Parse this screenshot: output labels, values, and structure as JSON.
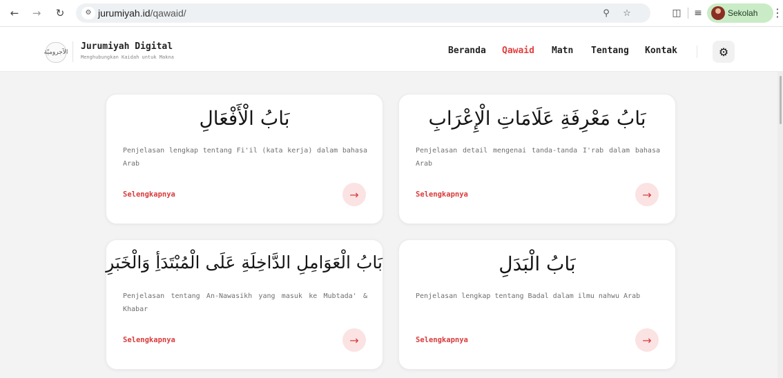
{
  "browser": {
    "url_domain": "jurumiyah.id",
    "url_path": "/qawaid/",
    "profile_name": "Sekolah",
    "icons": {
      "back": "back-arrow-icon",
      "forward": "forward-arrow-icon",
      "reload": "reload-icon",
      "site_info": "site-info-icon",
      "zoom": "zoom-icon",
      "bookmark": "star-icon",
      "extensions": "puzzle-icon",
      "media": "media-control-icon",
      "menu": "kebab-menu-icon"
    }
  },
  "site": {
    "logo_text": "الآجروميّة",
    "brand_title": "Jurumiyah Digital",
    "brand_subtitle": "Menghubungkan Kaidah untuk Makna",
    "nav": [
      {
        "label": "Beranda",
        "active": false
      },
      {
        "label": "Qawaid",
        "active": true
      },
      {
        "label": "Matn",
        "active": false
      },
      {
        "label": "Tentang",
        "active": false
      },
      {
        "label": "Kontak",
        "active": false
      }
    ],
    "accent_color": "#e23f3f",
    "settings_icon": "gear-icon"
  },
  "cards": [
    {
      "title": "بَابُ الْأَفْعَالِ",
      "description": "Penjelasan lengkap tentang Fi'il (kata kerja) dalam bahasa Arab",
      "link": "Selengkapnya"
    },
    {
      "title": "بَابُ مَعْرِفَةِ عَلَامَاتِ الْإِعْرَابِ",
      "description": "Penjelasan detail mengenai tanda-tanda I'rab dalam bahasa Arab",
      "link": "Selengkapnya"
    },
    {
      "title": "بَابُ الْعَوَامِلِ الدَّاخِلَةِ عَلَى الْمُبْتَدَأِ وَالْخَبَرِ",
      "description": "Penjelasan tentang An-Nawasikh yang masuk ke Mubtada' & Khabar",
      "link": "Selengkapnya"
    },
    {
      "title": "بَابُ الْبَدَلِ",
      "description": "Penjelasan lengkap tentang Badal dalam ilmu nahwu Arab",
      "link": "Selengkapnya"
    }
  ]
}
